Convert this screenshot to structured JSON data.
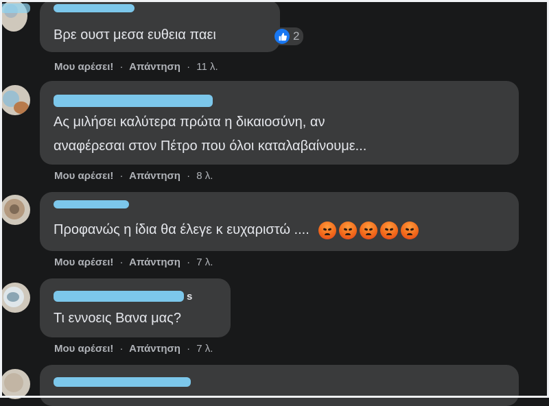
{
  "comments": [
    {
      "author_suffix": "",
      "text_lines": [
        "Βρε ουστ μεσα ευθεια παει"
      ],
      "likes": "2",
      "actions": {
        "like": "Μου αρέσει!",
        "reply": "Απάντηση",
        "time": "11 λ."
      }
    },
    {
      "author_suffix": "",
      "text_lines": [
        "Ας μιλήσει καλύτερα πρώτα η δικαιοσύνη, αν",
        "αναφέρεσαι στον Πέτρο που όλοι καταλαβαίνουμε..."
      ],
      "actions": {
        "like": "Μου αρέσει!",
        "reply": "Απάντηση",
        "time": "8 λ."
      }
    },
    {
      "author_suffix": "",
      "text_lines": [
        "Προφανώς η ίδια θα έλεγε κ ευχαριστώ ...."
      ],
      "emoji": [
        "angry-emoji",
        "angry-emoji",
        "angry-emoji",
        "angry-emoji",
        "angry-emoji"
      ],
      "actions": {
        "like": "Μου αρέσει!",
        "reply": "Απάντηση",
        "time": "7 λ."
      }
    },
    {
      "author_suffix": "s",
      "text_lines": [
        "Τι εννοεις Βανα μας?"
      ],
      "actions": {
        "like": "Μου αρέσει!",
        "reply": "Απάντηση",
        "time": "7 λ."
      }
    }
  ],
  "separator": "·",
  "colors": {
    "background": "#18191a",
    "bubble": "#3a3b3c",
    "text": "#e4e6eb",
    "meta": "#b0b3b8",
    "redaction": "#7fcff4",
    "like_blue": "#1877f2"
  },
  "icons": {
    "like": "thumbs-up-icon",
    "reaction": "angry-emoji"
  }
}
